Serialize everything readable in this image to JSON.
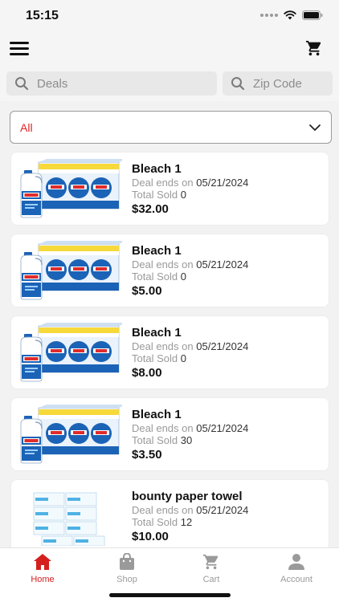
{
  "status_bar": {
    "time": "15:15"
  },
  "search": {
    "deals_placeholder": "Deals",
    "zip_placeholder": "Zip Code"
  },
  "filter": {
    "selected": "All"
  },
  "deals_labels": {
    "ends_prefix": "Deal ends on",
    "sold_prefix": "Total Sold"
  },
  "deals": [
    {
      "title": "Bleach 1",
      "ends": "05/21/2024",
      "sold": "0",
      "price": "$32.00",
      "image": "bleach-pack"
    },
    {
      "title": "Bleach 1",
      "ends": "05/21/2024",
      "sold": "0",
      "price": "$5.00",
      "image": "bleach-pack"
    },
    {
      "title": "Bleach 1",
      "ends": "05/21/2024",
      "sold": "0",
      "price": "$8.00",
      "image": "bleach-pack"
    },
    {
      "title": "Bleach 1",
      "ends": "05/21/2024",
      "sold": "30",
      "price": "$3.50",
      "image": "bleach-pack"
    },
    {
      "title": "bounty paper towel",
      "ends": "05/21/2024",
      "sold": "12",
      "price": "$10.00",
      "image": "paper-towel-pack"
    }
  ],
  "tabs": [
    {
      "label": "Home",
      "icon": "home-icon",
      "active": true
    },
    {
      "label": "Shop",
      "icon": "shopping-bag-icon",
      "active": false
    },
    {
      "label": "Cart",
      "icon": "cart-icon",
      "active": false
    },
    {
      "label": "Account",
      "icon": "account-icon",
      "active": false
    }
  ],
  "colors": {
    "accent": "#d51f1f",
    "filter_text": "#e21f1f",
    "background": "#f2f2f2",
    "card": "#ffffff"
  }
}
